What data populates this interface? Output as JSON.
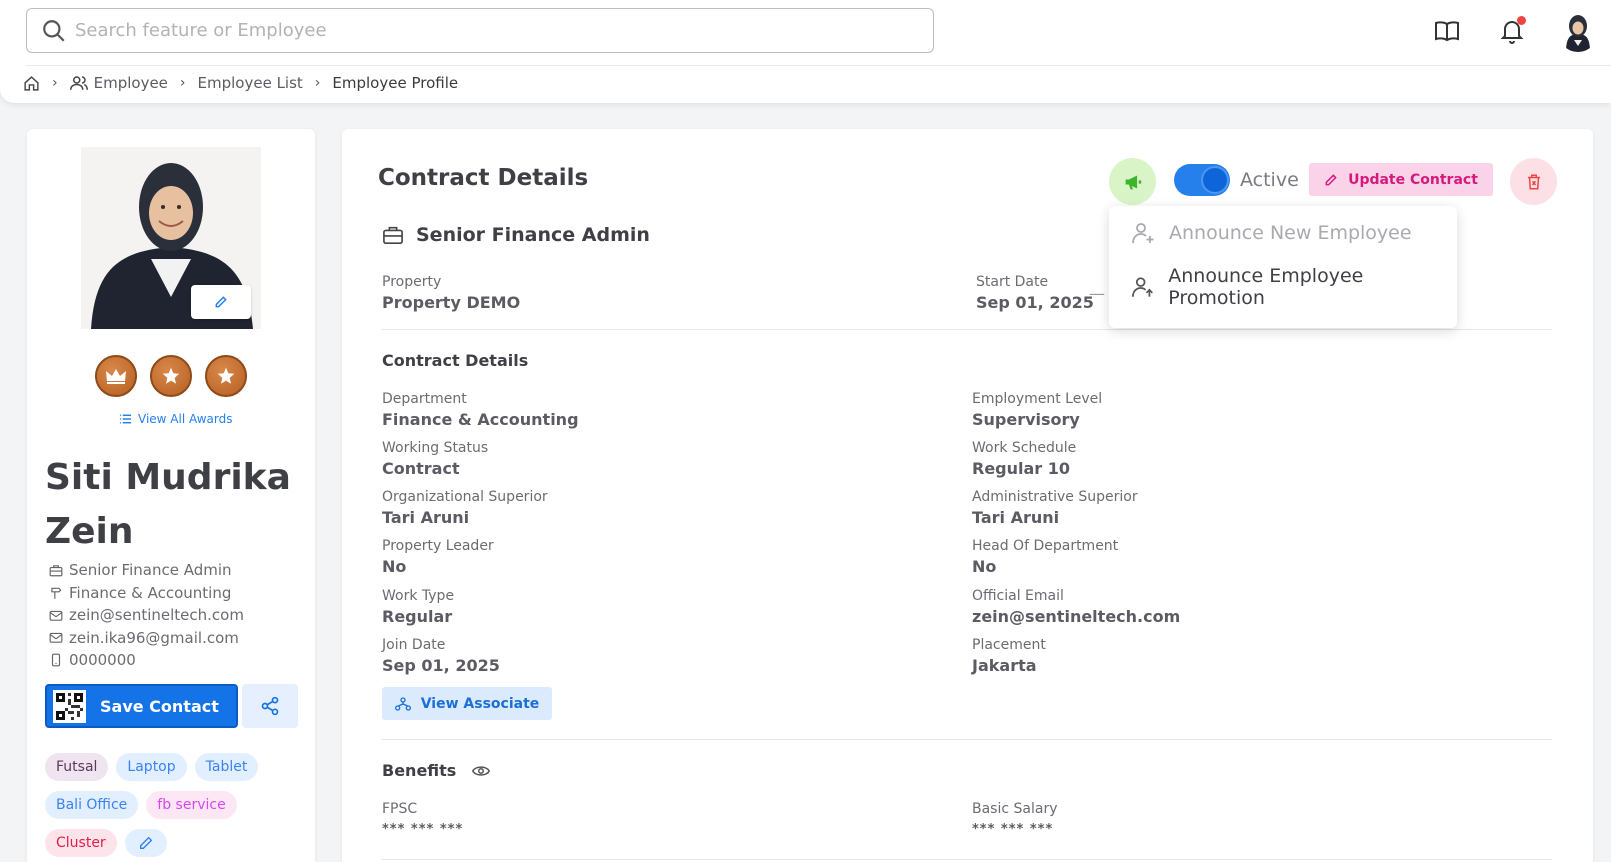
{
  "search": {
    "placeholder": "Search feature or Employee"
  },
  "breadcrumb": {
    "employee": "Employee",
    "list": "Employee List",
    "profile": "Employee Profile"
  },
  "profile": {
    "name": "Siti Mudrika Zein",
    "view_awards": "View All Awards",
    "position": "Senior Finance Admin",
    "department": "Finance & Accounting",
    "work_email": "zein@sentineltech.com",
    "personal_email": "zein.ika96@gmail.com",
    "phone": "0000000",
    "save_contact": "Save Contact",
    "tags": [
      "Futsal",
      "Laptop",
      "Tablet",
      "Bali Office",
      "fb service",
      "Cluster"
    ]
  },
  "contract": {
    "title": "Contract Details",
    "status": "Active",
    "update_label": "Update Contract",
    "position": "Senior Finance Admin",
    "property_label": "Property",
    "property": "Property DEMO",
    "start_label": "Start Date",
    "start": "Sep 01, 2025",
    "dash": "—",
    "section": "Contract Details",
    "fields": {
      "department_label": "Department",
      "department": "Finance & Accounting",
      "employment_level_label": "Employment Level",
      "employment_level": "Supervisory",
      "working_status_label": "Working Status",
      "working_status": "Contract",
      "work_schedule_label": "Work Schedule",
      "work_schedule": "Regular 10",
      "org_superior_label": "Organizational Superior",
      "org_superior": "Tari Aruni",
      "admin_superior_label": "Administrative Superior",
      "admin_superior": "Tari Aruni",
      "property_leader_label": "Property Leader",
      "property_leader": "No",
      "head_dept_label": "Head Of Department",
      "head_dept": "No",
      "work_type_label": "Work Type",
      "work_type": "Regular",
      "official_email_label": "Official Email",
      "official_email": "zein@sentineltech.com",
      "join_date_label": "Join Date",
      "join_date": "Sep 01, 2025",
      "placement_label": "Placement",
      "placement": "Jakarta"
    },
    "view_associate": "View Associate",
    "benefits_title": "Benefits",
    "fpsc_label": "FPSC",
    "fpsc": "*** *** ***",
    "basic_salary_label": "Basic Salary",
    "basic_salary": "*** *** ***"
  },
  "dropdown": {
    "new_employee": "Announce New Employee",
    "promotion": "Announce Employee Promotion"
  }
}
